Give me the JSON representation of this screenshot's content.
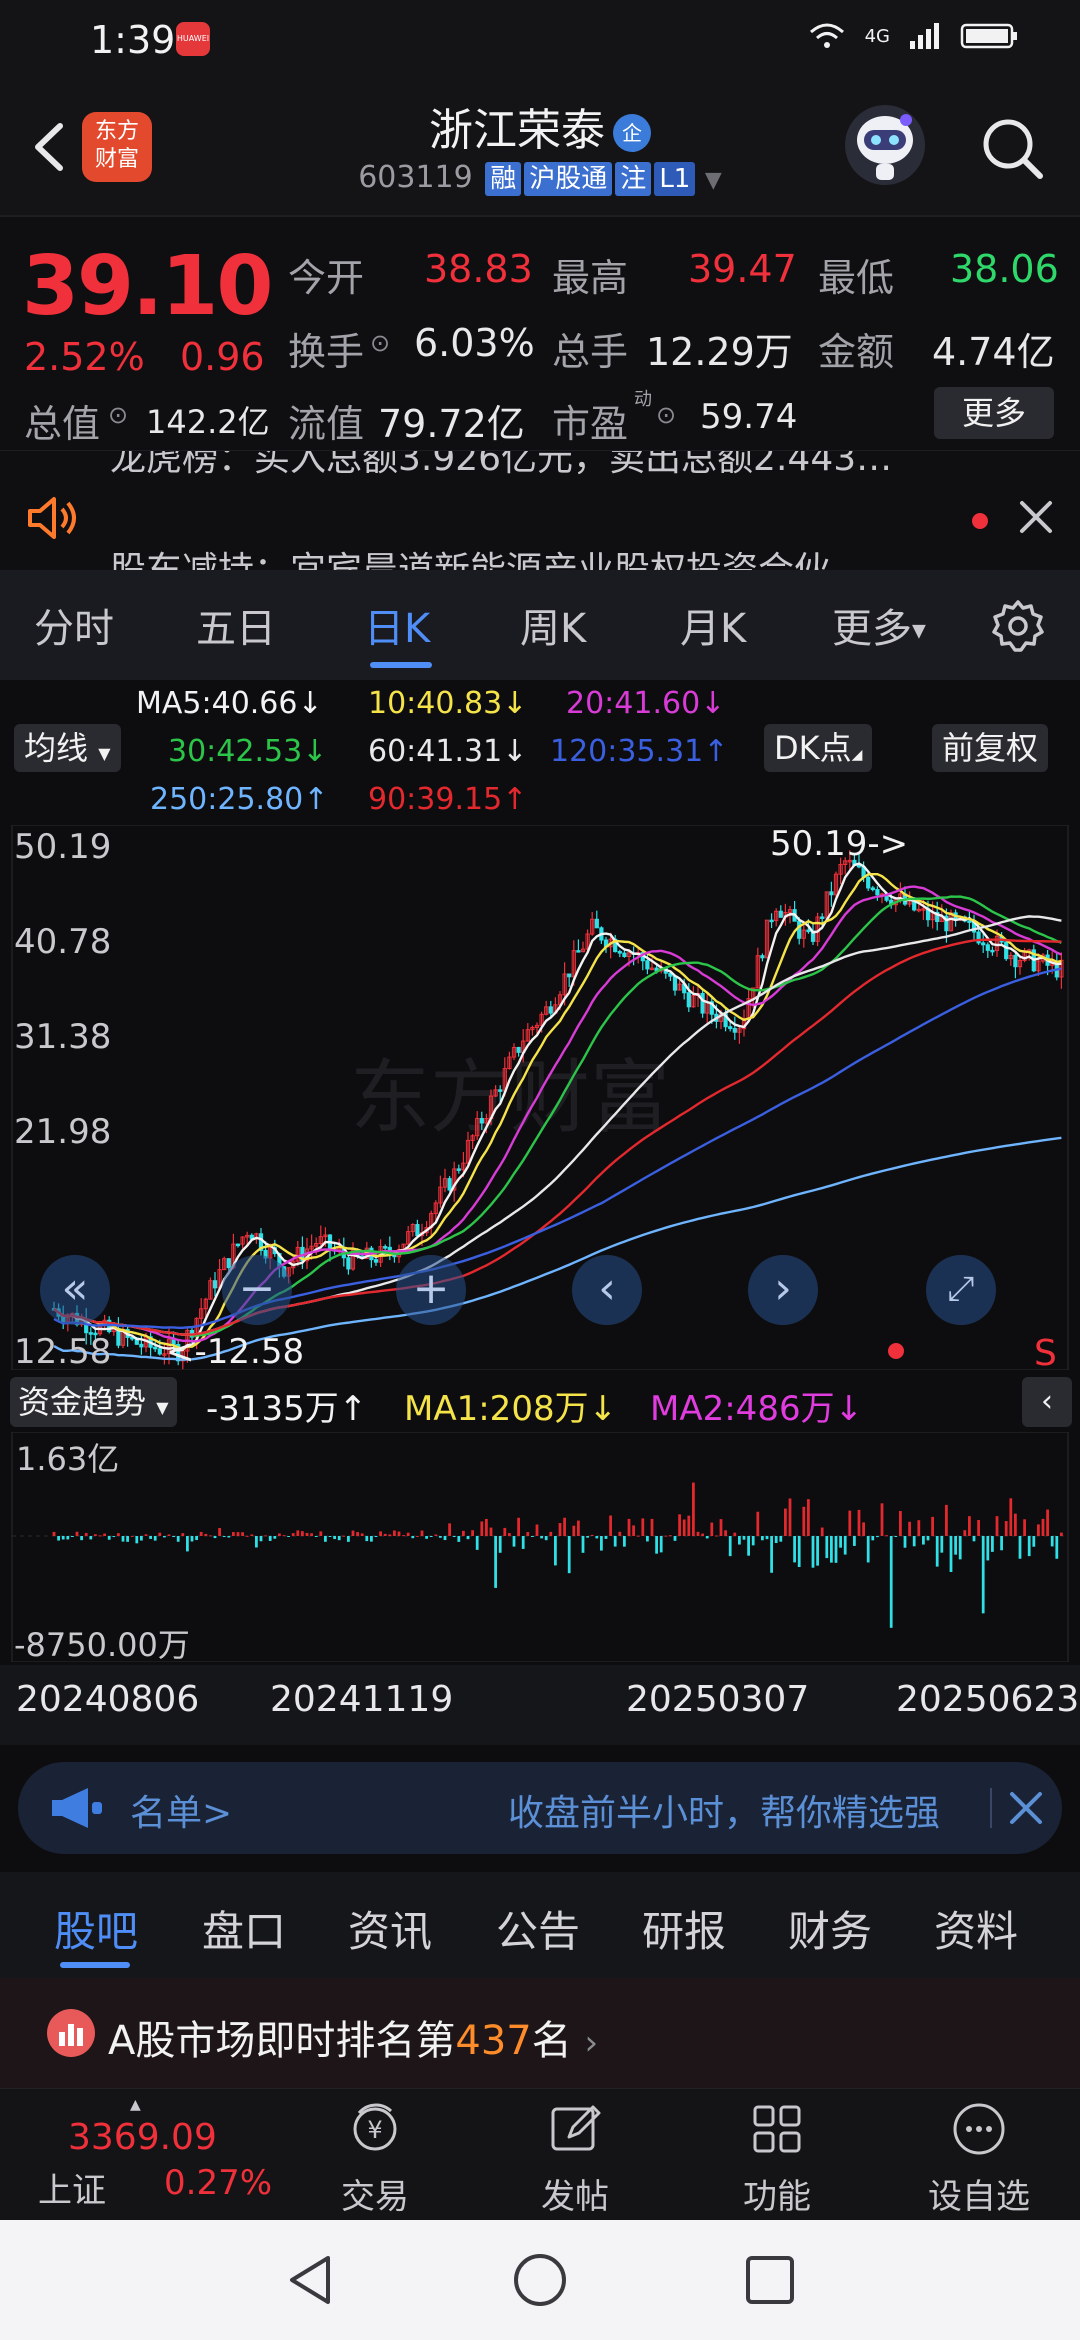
{
  "status": {
    "time": "1:39",
    "notif": "HUAWEI",
    "net": "4G"
  },
  "header": {
    "logo": [
      "东方",
      "财富"
    ],
    "name": "浙江荣泰",
    "badge": "企",
    "code": "603119",
    "tags": [
      "融",
      "沪股通",
      "注",
      "L1"
    ]
  },
  "quote": {
    "price": "39.10",
    "pct": "2.52%",
    "chg": "0.96",
    "labels": {
      "open": "今开",
      "high": "最高",
      "low": "最低",
      "turnover": "换手",
      "vol": "总手",
      "amount": "金额",
      "mktcap": "总值",
      "float": "流值",
      "pe": "市盈",
      "pe_sup": "动"
    },
    "values": {
      "open": "38.83",
      "high": "39.47",
      "low": "38.06",
      "turnover": "6.03%",
      "vol": "12.29万",
      "amount": "4.74亿",
      "mktcap": "142.2亿",
      "float": "79.72亿",
      "pe": "59.74"
    },
    "more": "更多"
  },
  "news": {
    "line_clipped": "龙虎榜：买入总额3.926亿元，卖出总额2.443…",
    "line": "股东减持：宜宾晨道新能源产业股权投资合伙"
  },
  "ktabs": [
    "分时",
    "五日",
    "日K",
    "周K",
    "月K",
    "更多"
  ],
  "ma": {
    "ma5": "MA5:40.66↓",
    "ma10": "10:40.83↓",
    "ma20": "20:41.60↓",
    "ma30": "30:42.53↓",
    "ma60": "60:41.31↓",
    "ma120": "120:35.31↑",
    "ma250": "250:25.80↑",
    "ma90": "90:39.15↑",
    "btn_ma": "均线",
    "btn_dk": "DK点",
    "btn_fq": "前复权",
    "colors": {
      "ma5": "#f2f2f2",
      "ma10": "#f5e34a",
      "ma20": "#d83bd6",
      "ma30": "#2cc54a",
      "ma60": "#e8e8ea",
      "ma120": "#3a5fe0",
      "ma250": "#6fb4ff",
      "ma90": "#e3282e"
    }
  },
  "kchart": {
    "y_labels": [
      "50.19",
      "40.78",
      "31.38",
      "21.98",
      "12.58"
    ],
    "high_annot": "50.19->",
    "low_annot": "<-12.58",
    "s_mark": "S"
  },
  "fund": {
    "selector": "资金趋势",
    "val": "-3135万↑",
    "ma1": "MA1:208万↓",
    "ma2": "MA2:486万↓",
    "y_top": "1.63亿",
    "y_bot": "-8750.00万"
  },
  "dates": [
    "20240806",
    "20241119",
    "20250307",
    "20250623"
  ],
  "banner": {
    "left": "名单>",
    "right": "收盘前半小时，帮你精选强"
  },
  "btabs": [
    "股吧",
    "盘口",
    "资讯",
    "公告",
    "研报",
    "财务",
    "资料"
  ],
  "rank": {
    "pre": "A股市场即时排名第",
    "num": "437",
    "post": "名"
  },
  "bnav": {
    "index_val": "3369.09",
    "index_name": "上证",
    "index_pct": "0.27%",
    "items": [
      "交易",
      "发帖",
      "功能",
      "设自选"
    ],
    "trade_glyph": "¥"
  }
}
